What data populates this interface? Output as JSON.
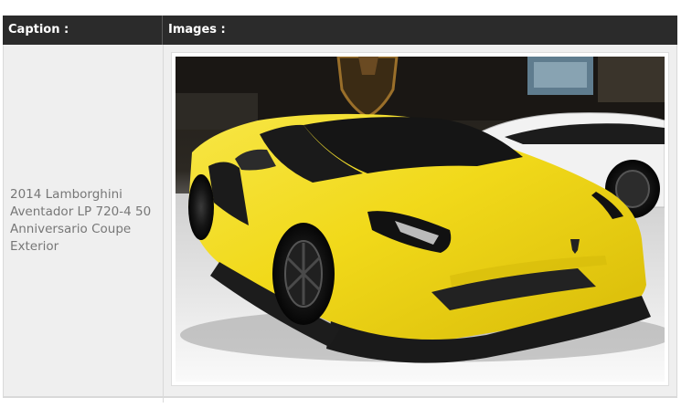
{
  "table": {
    "headers": {
      "caption": "Caption :",
      "images": "Images :"
    },
    "rows": [
      {
        "caption": "2014 Lamborghini Aventador LP 720-4 50 Anniversario Coupe Exterior",
        "image_subject": "yellow-lamborghini-aventador-photo"
      }
    ]
  },
  "colors": {
    "header_background": "#2b2b2b",
    "header_text": "#ffffff",
    "row_background": "#efefef",
    "caption_text": "#777777",
    "car_body": "#f2e01e"
  }
}
